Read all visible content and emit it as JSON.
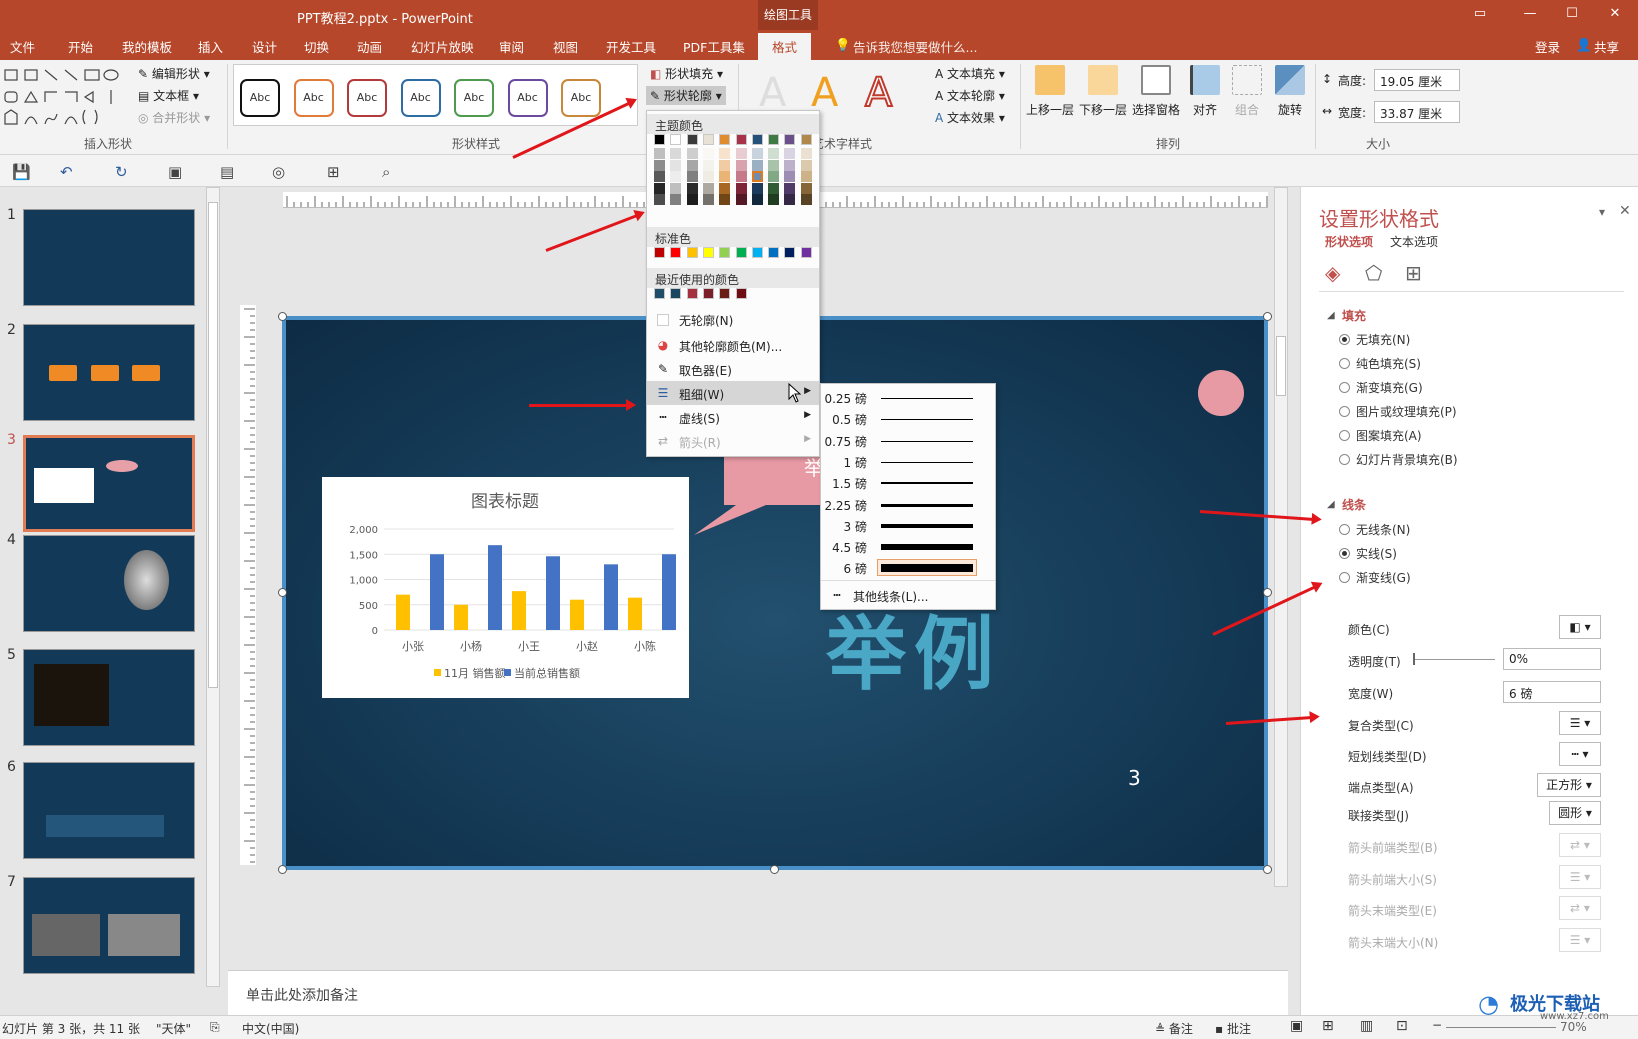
{
  "window": {
    "title": "PPT教程2.pptx - PowerPoint",
    "context_tab_group": "绘图工具"
  },
  "tabs": [
    "文件",
    "开始",
    "我的模板",
    "插入",
    "设计",
    "切换",
    "动画",
    "幻灯片放映",
    "审阅",
    "视图",
    "开发工具",
    "PDF工具集",
    "格式"
  ],
  "active_tab": "格式",
  "tell_me": "告诉我您想要做什么...",
  "account": {
    "login": "登录",
    "share": "共享"
  },
  "ribbon": {
    "insert_shapes": {
      "label": "插入形状",
      "edit_shape": "编辑形状",
      "textbox": "文本框",
      "merge_shapes": "合并形状"
    },
    "shape_styles": {
      "label": "形状样式",
      "sample": "Abc",
      "fill": "形状填充",
      "outline": "形状轮廓",
      "style_colors": [
        "#111111",
        "#e07b39",
        "#b23a3a",
        "#2e6ca4",
        "#4e9a4e",
        "#6a4a9e",
        "#c8873a"
      ]
    },
    "wordart": {
      "label": "艺术字样式",
      "text_fill": "文本填充",
      "text_outline": "文本轮廓",
      "text_effect": "文本效果"
    },
    "arrange": {
      "label": "排列",
      "bring_forward": "上移一层",
      "send_backward": "下移一层",
      "selection_pane": "选择窗格",
      "align": "对齐",
      "group": "组合",
      "rotate": "旋转"
    },
    "size": {
      "label": "大小",
      "height_label": "高度:",
      "height": "19.05 厘米",
      "width_label": "宽度:",
      "width": "33.87 厘米"
    }
  },
  "outline_menu": {
    "theme_colors_label": "主题颜色",
    "theme_top": [
      "#000000",
      "#ffffff",
      "#3a3a3a",
      "#e7e1d6",
      "#e08b2e",
      "#a8324a",
      "#24507a",
      "#3f7a44",
      "#6a4f8a",
      "#b0884a"
    ],
    "standard_label": "标准色",
    "standard": [
      "#c00000",
      "#ff0000",
      "#ffc000",
      "#ffff00",
      "#92d050",
      "#00b050",
      "#00b0f0",
      "#0070c0",
      "#002060",
      "#7030a0"
    ],
    "recent_label": "最近使用的颜色",
    "recent": [
      "#1f4e6b",
      "#1a4662",
      "#a5303e",
      "#7b1f2b",
      "#6b1c14",
      "#6e0d12"
    ],
    "no_outline": "无轮廓(N)",
    "more_colors": "其他轮廓颜色(M)...",
    "eyedropper": "取色器(E)",
    "weight": "粗细(W)",
    "dashes": "虚线(S)",
    "arrows": "箭头(R)"
  },
  "weight_submenu": {
    "items": [
      {
        "label": "0.25 磅",
        "pt": 0.25
      },
      {
        "label": "0.5 磅",
        "pt": 0.5
      },
      {
        "label": "0.75 磅",
        "pt": 0.75
      },
      {
        "label": "1 磅",
        "pt": 1
      },
      {
        "label": "1.5 磅",
        "pt": 1.5
      },
      {
        "label": "2.25 磅",
        "pt": 2.25
      },
      {
        "label": "3 磅",
        "pt": 3
      },
      {
        "label": "4.5 磅",
        "pt": 4.5
      },
      {
        "label": "6 磅",
        "pt": 6
      }
    ],
    "selected": "6 磅",
    "more": "其他线条(L)..."
  },
  "slides_panel": {
    "numbers": [
      "1",
      "2",
      "3",
      "4",
      "5",
      "6",
      "7"
    ],
    "selected": "3"
  },
  "slide": {
    "title": "举例",
    "callout": "举",
    "page_number": "3"
  },
  "chart_data": {
    "type": "bar",
    "title": "图表标题",
    "categories": [
      "小张",
      "小杨",
      "小王",
      "小赵",
      "小陈"
    ],
    "series": [
      {
        "name": "11月 销售额",
        "color": "#ffc000",
        "values": [
          700,
          500,
          770,
          600,
          640
        ]
      },
      {
        "name": "当前总销售额",
        "color": "#4472c4",
        "values": [
          1500,
          1680,
          1460,
          1300,
          1500
        ]
      }
    ],
    "yticks": [
      "0",
      "500",
      "1,000",
      "1,500",
      "2,000"
    ],
    "ylim": [
      0,
      2000
    ]
  },
  "notes_placeholder": "单击此处添加备注",
  "format_pane": {
    "title": "设置形状格式",
    "tab_shape": "形状选项",
    "tab_text": "文本选项",
    "fill_header": "填充",
    "fill_options": [
      "无填充(N)",
      "纯色填充(S)",
      "渐变填充(G)",
      "图片或纹理填充(P)",
      "图案填充(A)",
      "幻灯片背景填充(B)"
    ],
    "fill_selected": "无填充(N)",
    "line_header": "线条",
    "line_options": [
      "无线条(N)",
      "实线(S)",
      "渐变线(G)"
    ],
    "line_selected": "实线(S)",
    "color_label": "颜色(C)",
    "transparency_label": "透明度(T)",
    "transparency_value": "0%",
    "width_label": "宽度(W)",
    "width_value": "6 磅",
    "compound_label": "复合类型(C)",
    "dash_label": "短划线类型(D)",
    "cap_label": "端点类型(A)",
    "cap_value": "正方形",
    "join_label": "联接类型(J)",
    "join_value": "圆形",
    "begin_arrow_type": "箭头前端类型(B)",
    "begin_arrow_size": "箭头前端大小(S)",
    "end_arrow_type": "箭头末端类型(E)",
    "end_arrow_size": "箭头末端大小(N)"
  },
  "status": {
    "slide_info": "幻灯片 第 3 张，共 11 张",
    "theme": "\"天体\"",
    "language": "中文(中国)",
    "notes": "备注",
    "comments": "批注",
    "zoom": "70%"
  },
  "watermark": {
    "site": "极光下载站",
    "url": "www.xz7.com"
  }
}
